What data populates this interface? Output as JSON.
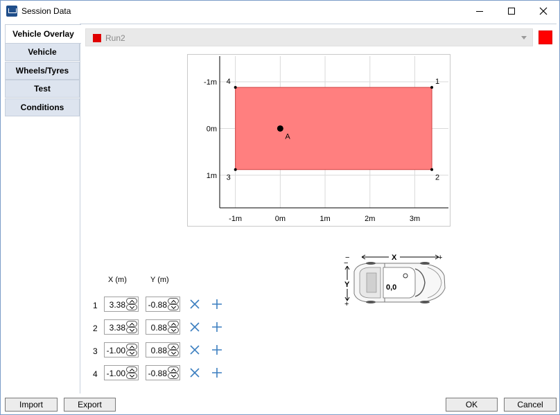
{
  "window": {
    "title": "Session Data"
  },
  "tabs": [
    {
      "label": "Vehicle Overlay",
      "active": true
    },
    {
      "label": "Vehicle",
      "active": false
    },
    {
      "label": "Wheels/Tyres",
      "active": false
    },
    {
      "label": "Test",
      "active": false
    },
    {
      "label": "Conditions",
      "active": false
    }
  ],
  "run": {
    "label": "Run2",
    "swatch_color": "#e00000",
    "overlay_color": "#ff0000"
  },
  "chart_data": {
    "type": "scatter",
    "x_ticks": [
      "-1m",
      "0m",
      "1m",
      "2m",
      "3m"
    ],
    "y_ticks": [
      "-1m",
      "0m",
      "1m"
    ],
    "xlim": [
      -1.35,
      3.75
    ],
    "ylim": [
      -1.55,
      1.7
    ],
    "polygon": [
      {
        "label": "1",
        "x": 3.38,
        "y": -0.88
      },
      {
        "label": "2",
        "x": 3.38,
        "y": 0.88
      },
      {
        "label": "3",
        "x": -1.0,
        "y": 0.88
      },
      {
        "label": "4",
        "x": -1.0,
        "y": -0.88
      }
    ],
    "fill_color": "#ff7f7f",
    "anchor": {
      "label": "A",
      "x": 0,
      "y": 0
    },
    "grid": true
  },
  "table": {
    "x_header": "X (m)",
    "y_header": "Y (m)",
    "rows": [
      {
        "n": "1",
        "x": "3.38",
        "y": "-0.88"
      },
      {
        "n": "2",
        "x": "3.38",
        "y": "0.88"
      },
      {
        "n": "3",
        "x": "-1.00",
        "y": "0.88"
      },
      {
        "n": "4",
        "x": "-1.00",
        "y": "-0.88"
      }
    ]
  },
  "car": {
    "x_label": "X",
    "y_label": "Y",
    "origin_label": "0,0",
    "minus": "−",
    "plus": "+"
  },
  "buttons": {
    "import": "Import",
    "export": "Export",
    "ok": "OK",
    "cancel": "Cancel"
  },
  "icons": {
    "delete": "x-icon",
    "add": "plus-icon",
    "icon_color": "#3c7fc0"
  }
}
